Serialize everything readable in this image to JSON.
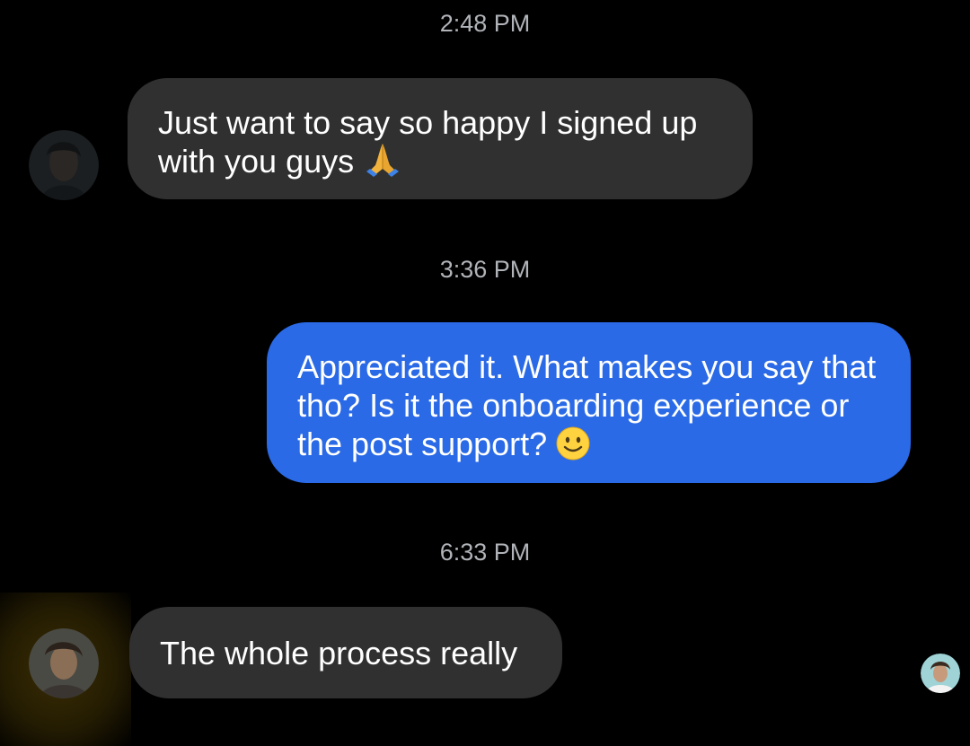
{
  "conversation": {
    "messages": [
      {
        "timestamp": "2:48 PM",
        "direction": "incoming",
        "text": "Just want to say so happy I signed up with you guys",
        "emoji": "folded-hands"
      },
      {
        "timestamp": "3:36 PM",
        "direction": "outgoing",
        "text": "Appreciated it. What makes you say that tho? Is it the onboarding experience or the post support?",
        "emoji": "slightly-smiling-face"
      },
      {
        "timestamp": "6:33 PM",
        "direction": "incoming",
        "text": "The whole process really",
        "emoji": null
      }
    ]
  },
  "colors": {
    "background": "#000000",
    "incoming_bubble": "#303030",
    "outgoing_bubble": "#2a6ae6",
    "timestamp_text": "#b0b3b8",
    "message_text": "#ffffff"
  }
}
